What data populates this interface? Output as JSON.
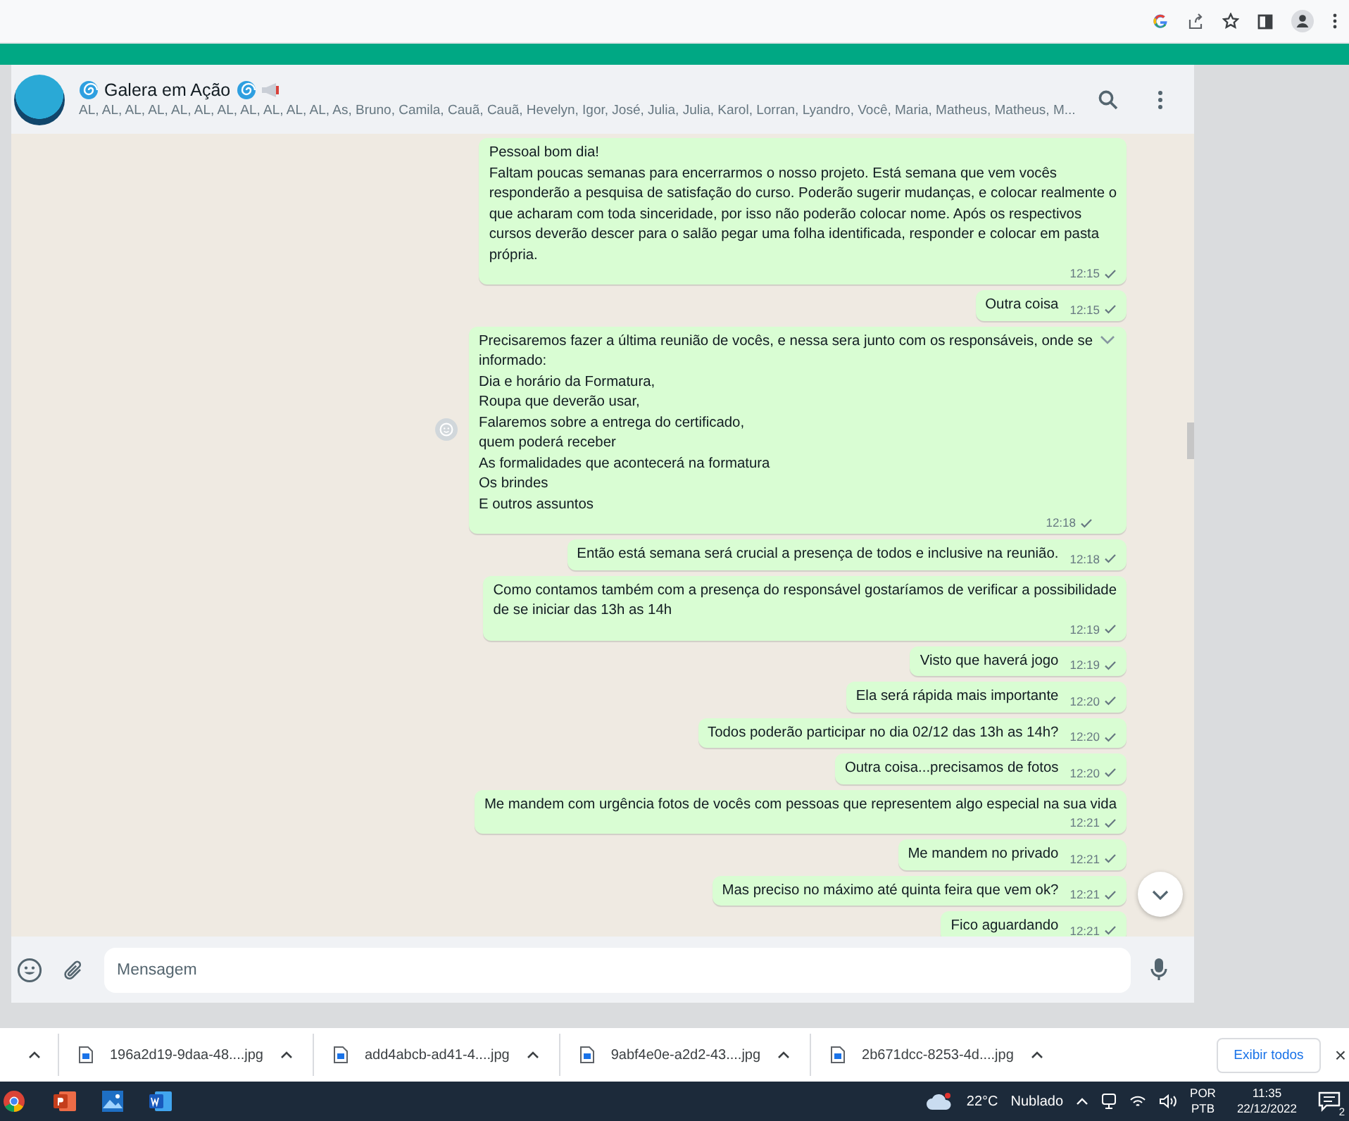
{
  "chat": {
    "title": "Galera em Ação",
    "members": "AL, AL, AL, AL, AL, AL, AL, AL, AL, AL, AL, As, Bruno, Camila, Cauã, Cauã, Hevelyn, Igor, José, Julia, Julia, Karol, Lorran, Lyandro, Você, Maria, Matheus, Matheus, M..."
  },
  "messages": [
    {
      "text": "Pessoal bom dia!\nFaltam poucas semanas para encerrarmos o nosso projeto. Está semana que vem vocês\nresponderão a pesquisa de satisfação do curso. Poderão sugerir mudanças, e colocar realmente o\nque acharam com toda sinceridade, por isso não poderão colocar nome. Após os respectivos\ncursos deverão descer para o salão pegar uma folha identificada, responder e colocar em pasta\nprópria.",
      "time": "12:15",
      "hovered": false
    },
    {
      "text": "Outra coisa",
      "time": "12:15",
      "hovered": false
    },
    {
      "text": "Precisaremos fazer a última reunião de vocês, e nessa sera junto com os responsáveis, onde se\ninformado:\nDia e horário da Formatura,\nRoupa que deverão usar,\nFalaremos sobre a entrega do certificado,\nquem poderá receber\nAs formalidades que acontecerá na formatura\nOs brindes\nE outros assuntos",
      "time": "12:18",
      "hovered": true
    },
    {
      "text": "Então está semana será crucial a presença de todos e inclusive na reunião.",
      "time": "12:18",
      "hovered": false
    },
    {
      "text": "Como contamos também com a presença do responsável gostaríamos de verificar a possibilidade\nde se iniciar das 13h as 14h",
      "time": "12:19",
      "hovered": false
    },
    {
      "text": "Visto que haverá jogo",
      "time": "12:19",
      "hovered": false
    },
    {
      "text": "Ela será rápida mais importante",
      "time": "12:20",
      "hovered": false
    },
    {
      "text": "Todos poderão participar no dia 02/12 das 13h as 14h?",
      "time": "12:20",
      "hovered": false
    },
    {
      "text": "Outra coisa...precisamos de fotos",
      "time": "12:20",
      "hovered": false
    },
    {
      "text": "Me mandem com urgência fotos de vocês com pessoas que representem algo especial na sua vida\n",
      "time": "12:21",
      "hovered": false
    },
    {
      "text": "Me mandem no privado",
      "time": "12:21",
      "hovered": false
    },
    {
      "text": "Mas preciso no máximo até quinta feira que vem ok?",
      "time": "12:21",
      "hovered": false
    },
    {
      "text": "Fico aguardando",
      "time": "12:21",
      "hovered": false
    }
  ],
  "composer": {
    "placeholder": "Mensagem"
  },
  "downloads": {
    "items": [
      {
        "name": "196a2d19-9daa-48....jpg"
      },
      {
        "name": "add4abcb-ad41-4....jpg"
      },
      {
        "name": "9abf4e0e-a2d2-43....jpg"
      },
      {
        "name": "2b671dcc-8253-4d....jpg"
      }
    ],
    "show_all": "Exibir todos",
    "close": "×"
  },
  "taskbar": {
    "temperature": "22°C",
    "weather": "Nublado",
    "lang_top": "POR",
    "lang_bottom": "PTB",
    "time": "11:35",
    "date": "22/12/2022",
    "notifications": "2"
  }
}
